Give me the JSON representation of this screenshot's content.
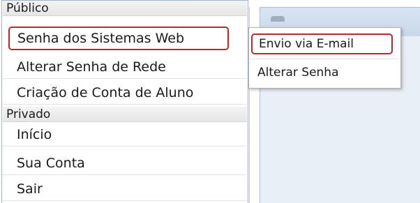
{
  "menu": {
    "public_header": "Público",
    "public_items": [
      {
        "label": "Senha dos Sistemas Web"
      },
      {
        "label": "Alterar Senha de Rede"
      },
      {
        "label": "Criação de Conta de Aluno"
      }
    ],
    "private_header": "Privado",
    "private_items": [
      {
        "label": "Início"
      },
      {
        "label": "Sua Conta"
      },
      {
        "label": "Sair"
      }
    ]
  },
  "submenu": {
    "items": [
      {
        "label": "Envio via E-mail"
      },
      {
        "label": "Alterar Senha"
      }
    ]
  },
  "colors": {
    "highlight_border": "#c0252c",
    "panel_border": "#a8bedb",
    "panel_header": "#d8e4f2"
  }
}
